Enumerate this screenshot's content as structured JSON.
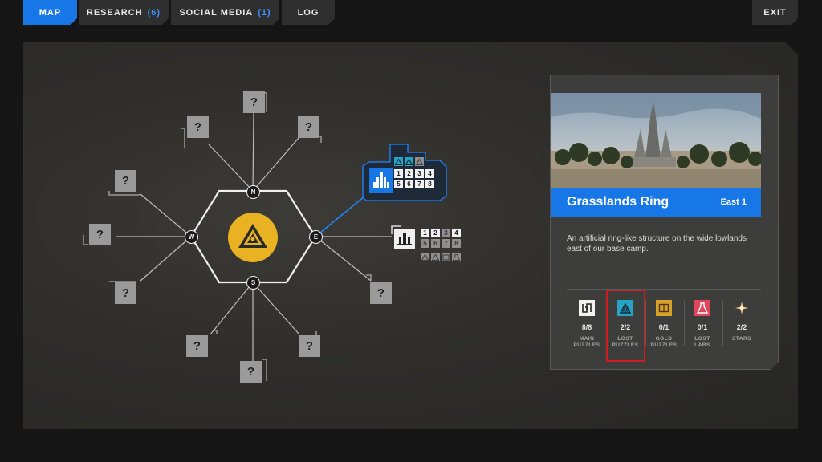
{
  "nav": {
    "tabs": [
      {
        "label": "MAP",
        "count": ""
      },
      {
        "label": "RESEARCH",
        "count": "(6)"
      },
      {
        "label": "SOCIAL MEDIA",
        "count": "(1)"
      },
      {
        "label": "LOG",
        "count": ""
      }
    ],
    "exit_label": "EXIT",
    "active_tab": "MAP"
  },
  "map": {
    "unknown_symbol": "?",
    "compass": {
      "north": "N",
      "south": "S",
      "east": "E",
      "west": "W"
    },
    "hub_icon": "pyramid-icon",
    "locations": [
      {
        "id": "east-1",
        "selected": true,
        "icon": "ring-tower-icon",
        "lost_puzzle_row": [
          "triangle",
          "triangle",
          "triangle-gray"
        ],
        "puzzles": [
          "1",
          "2",
          "3",
          "4",
          "5",
          "6",
          "7",
          "8"
        ]
      },
      {
        "id": "east-2",
        "selected": false,
        "icon": "castle-icon",
        "lost_puzzle_row": [
          "triangle-gray",
          "triangle-gray",
          "book-gray",
          "flask-gray"
        ],
        "puzzles": [
          "1",
          "2",
          "3",
          "4",
          "5",
          "6",
          "7",
          "8"
        ],
        "completed_puzzles": [
          "1",
          "2",
          "4"
        ]
      }
    ]
  },
  "card": {
    "title": "Grasslands Ring",
    "region": "East 1",
    "description": "An artificial ring-like structure on the wide lowlands east of our base camp.",
    "stats": [
      {
        "value": "8/8",
        "label_1": "MAIN",
        "label_2": "PUZZLES",
        "icon": "main-puzzle-icon",
        "color": "#f2f2f2"
      },
      {
        "value": "2/2",
        "label_1": "LOST",
        "label_2": "PUZZLES",
        "icon": "lost-puzzle-icon",
        "color": "#27a3c6"
      },
      {
        "value": "0/1",
        "label_1": "GOLD",
        "label_2": "PUZZLES",
        "icon": "gold-puzzle-icon",
        "color": "#d4a12a"
      },
      {
        "value": "0/1",
        "label_1": "LOST",
        "label_2": "LABS",
        "icon": "lab-flask-icon",
        "color": "#e0455a"
      },
      {
        "value": "2/2",
        "label_1": "STARS",
        "label_2": "",
        "icon": "star-icon",
        "color": "#f0c890"
      }
    ],
    "highlighted_stat": "LOST PUZZLES"
  },
  "colors": {
    "accent": "#1877e6",
    "hub": "#e8b222",
    "highlight": "#d01c1c"
  }
}
